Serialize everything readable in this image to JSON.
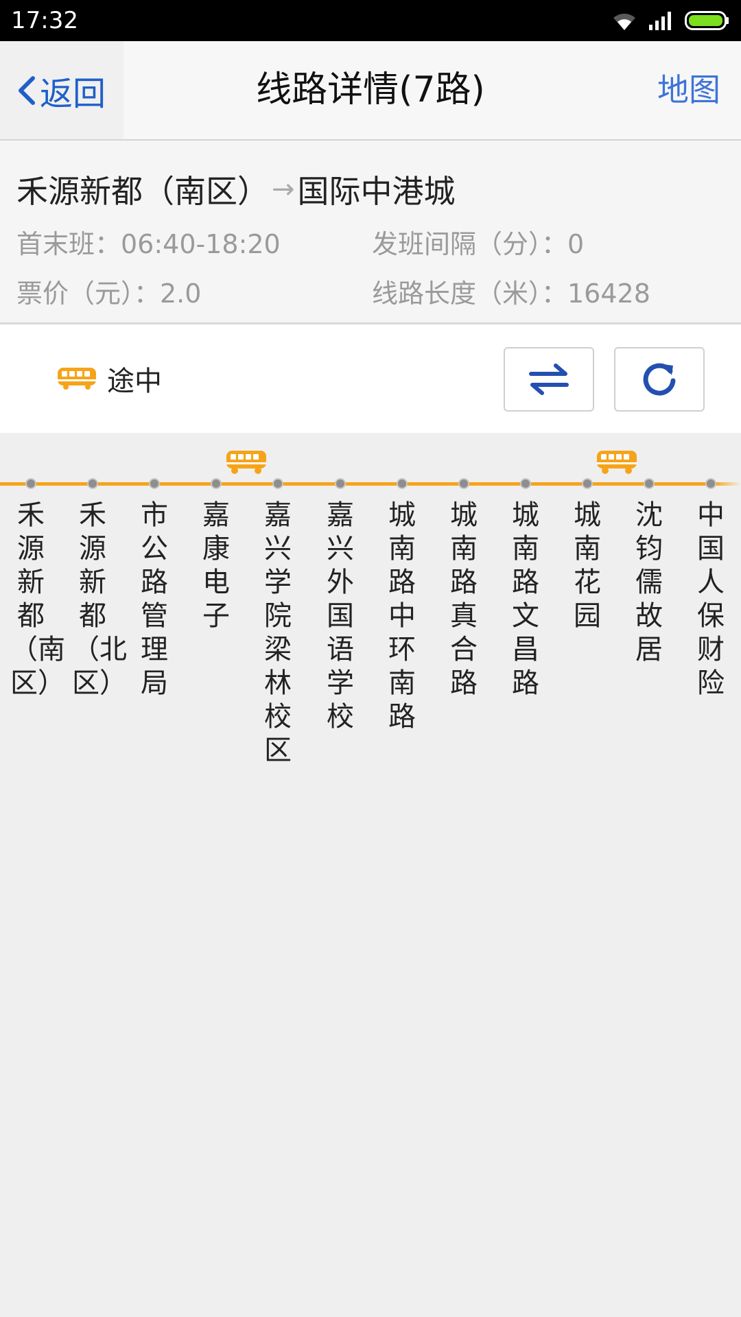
{
  "status_bar": {
    "time": "17:32"
  },
  "nav": {
    "back_label": "返回",
    "title": "线路详情(7路)",
    "map_label": "地图"
  },
  "route": {
    "from": "禾源新都（南区）",
    "arrow": "→",
    "to": "国际中港城",
    "first_last": "首末班：06:40-18:20",
    "interval": "发班间隔（分）：0",
    "fare": "票价（元）：2.0",
    "length": "线路长度（米）：16428"
  },
  "bus_status": {
    "label": "途中"
  },
  "colors": {
    "accent": "#f5a41a",
    "link": "#1f5fc9",
    "icon": "#2350b0"
  },
  "stops": [
    {
      "name": "禾源新都（南区）"
    },
    {
      "name": "禾源新都（北区）"
    },
    {
      "name": "市公路管理局"
    },
    {
      "name": "嘉康电子"
    },
    {
      "name": "嘉兴学院梁林校区"
    },
    {
      "name": "嘉兴外国语学校"
    },
    {
      "name": "城南路中环南路"
    },
    {
      "name": "城南路真合路"
    },
    {
      "name": "城南路文昌路"
    },
    {
      "name": "城南花园"
    },
    {
      "name": "沈钧儒故居"
    },
    {
      "name": "中国人保财险"
    }
  ]
}
